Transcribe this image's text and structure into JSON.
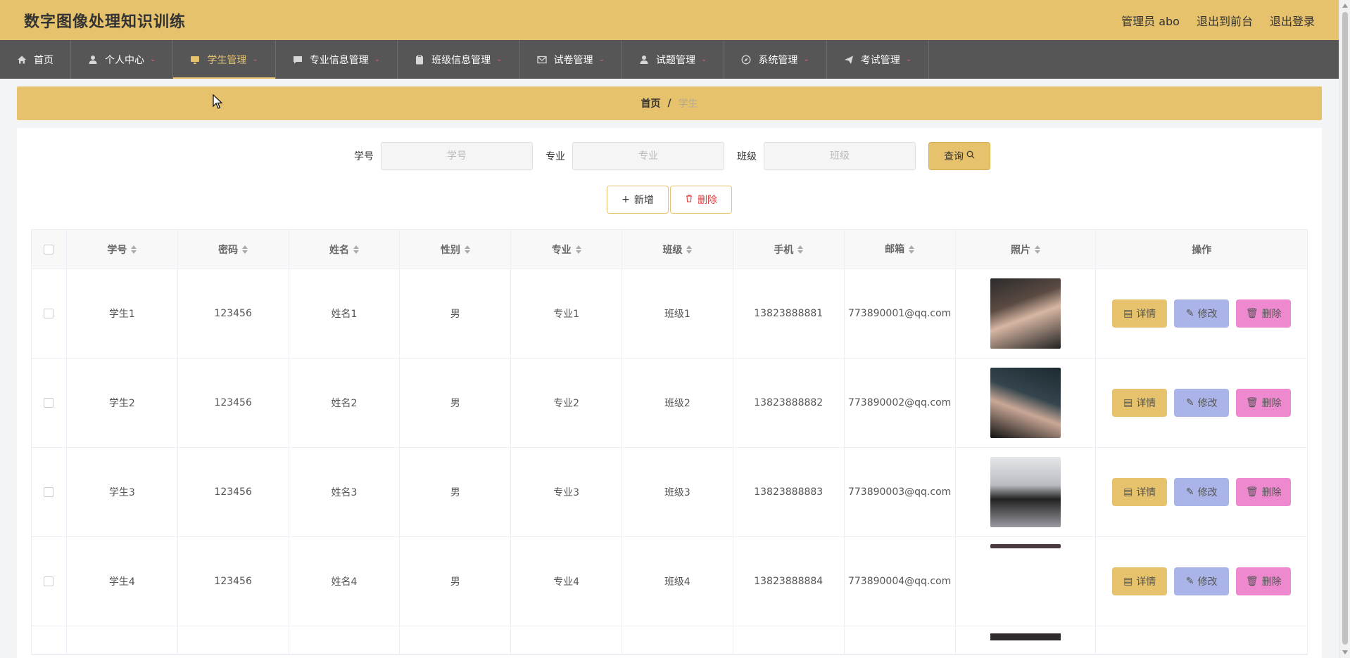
{
  "app": {
    "title": "数字图像处理知识训练",
    "actions": [
      "管理员 abo",
      "退出到前台",
      "退出登录"
    ]
  },
  "nav": [
    {
      "label": "首页",
      "icon": "home-icon",
      "active": false,
      "has_arrow": false
    },
    {
      "label": "个人中心",
      "icon": "user-icon",
      "active": false,
      "has_arrow": true
    },
    {
      "label": "学生管理",
      "icon": "monitor-icon",
      "active": true,
      "has_arrow": true
    },
    {
      "label": "专业信息管理",
      "icon": "chat-icon",
      "active": false,
      "has_arrow": true
    },
    {
      "label": "班级信息管理",
      "icon": "clipboard-icon",
      "active": false,
      "has_arrow": true
    },
    {
      "label": "试卷管理",
      "icon": "mail-icon",
      "active": false,
      "has_arrow": true
    },
    {
      "label": "试题管理",
      "icon": "user-icon",
      "active": false,
      "has_arrow": true
    },
    {
      "label": "系统管理",
      "icon": "compass-icon",
      "active": false,
      "has_arrow": true
    },
    {
      "label": "考试管理",
      "icon": "send-icon",
      "active": false,
      "has_arrow": true
    }
  ],
  "breadcrumb": {
    "home": "首页",
    "separator": "/",
    "current": "学生"
  },
  "search": {
    "fields": [
      {
        "label": "学号",
        "placeholder": "学号",
        "value": ""
      },
      {
        "label": "专业",
        "placeholder": "专业",
        "value": ""
      },
      {
        "label": "班级",
        "placeholder": "班级",
        "value": ""
      }
    ],
    "query_label": "查询"
  },
  "actions": {
    "add_label": "新增",
    "delete_label": "删除"
  },
  "table": {
    "columns": [
      "学号",
      "密码",
      "姓名",
      "性别",
      "专业",
      "班级",
      "手机",
      "邮箱",
      "照片",
      "操作"
    ],
    "rows": [
      {
        "id": "学生1",
        "password": "123456",
        "name": "姓名1",
        "gender": "男",
        "major": "专业1",
        "class": "班级1",
        "phone": "13823888881",
        "email": "773890001@qq.com"
      },
      {
        "id": "学生2",
        "password": "123456",
        "name": "姓名2",
        "gender": "男",
        "major": "专业2",
        "class": "班级2",
        "phone": "13823888882",
        "email": "773890002@qq.com"
      },
      {
        "id": "学生3",
        "password": "123456",
        "name": "姓名3",
        "gender": "男",
        "major": "专业3",
        "class": "班级3",
        "phone": "13823888883",
        "email": "773890003@qq.com"
      },
      {
        "id": "学生4",
        "password": "123456",
        "name": "姓名4",
        "gender": "男",
        "major": "专业4",
        "class": "班级4",
        "phone": "13823888884",
        "email": "773890004@qq.com"
      }
    ],
    "row_buttons": {
      "detail": "详情",
      "edit": "修改",
      "delete": "删除"
    }
  },
  "colors": {
    "accent": "#e6c26d",
    "nav_bg": "#565656",
    "edit_btn": "#aab4e8",
    "delete_btn": "#ee88cf",
    "danger_text": "#e23a3a"
  }
}
